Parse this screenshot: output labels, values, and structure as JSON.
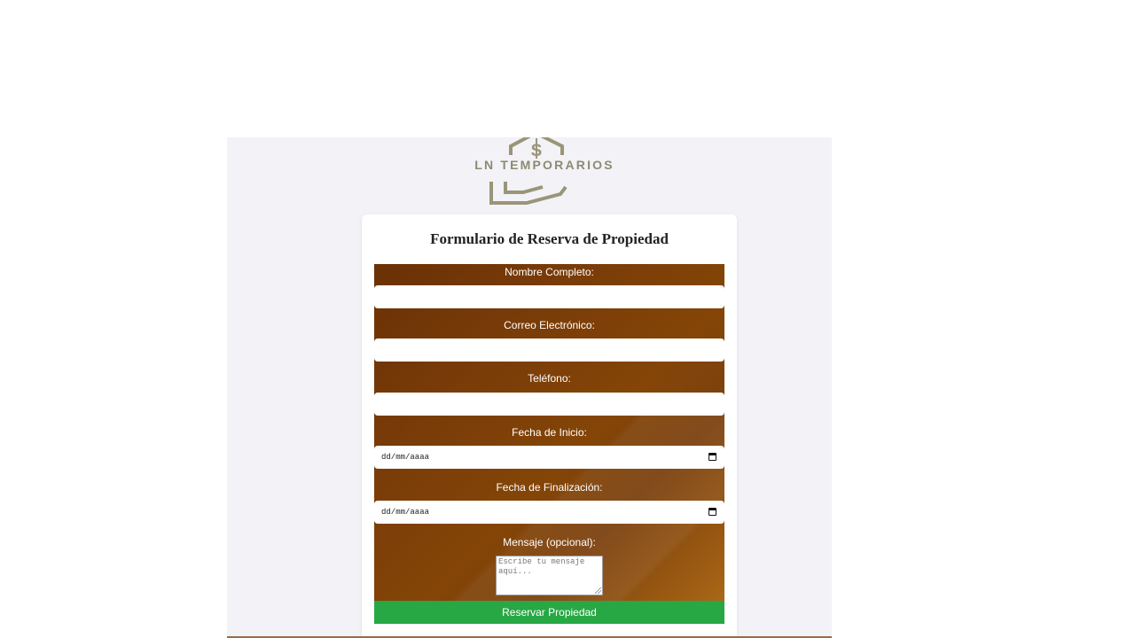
{
  "brand": {
    "name": "LN TEMPORARIOS"
  },
  "form": {
    "title": "Formulario de Reserva de Propiedad",
    "fields": {
      "name_label": "Nombre Completo:",
      "email_label": "Correo Electrónico:",
      "phone_label": "Teléfono:",
      "start_label": "Fecha de Inicio:",
      "start_value": "dd/mm/aaaa",
      "end_label": "Fecha de Finalización:",
      "end_value": "dd/mm/aaaa",
      "message_label": "Mensaje (opcional):",
      "message_placeholder": "Escribe tu mensaje aquí..."
    },
    "submit_label": "Reservar Propiedad"
  },
  "colors": {
    "submit": "#27a844",
    "form_background": "#7a3c08",
    "logo": "#8f8a70"
  }
}
